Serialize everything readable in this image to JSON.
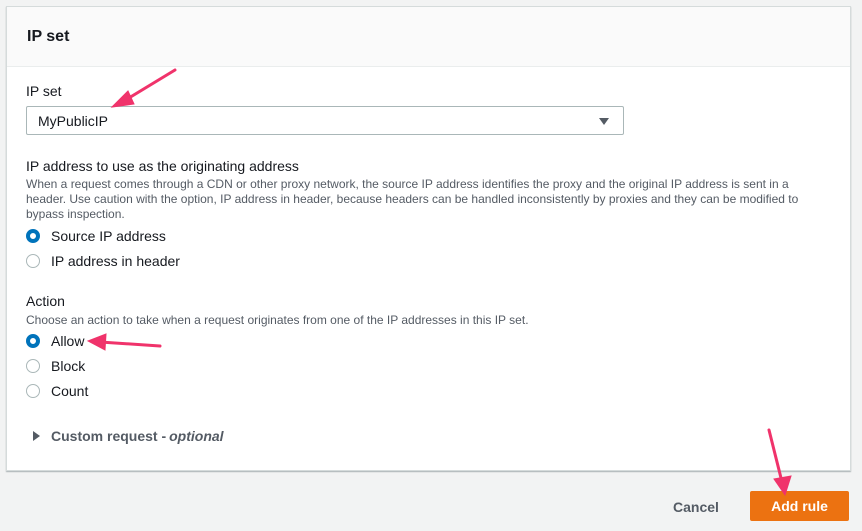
{
  "panel": {
    "title": "IP set"
  },
  "ipset": {
    "label": "IP set",
    "selected": "MyPublicIP"
  },
  "origin": {
    "label": "IP address to use as the originating address",
    "description": "When a request comes through a CDN or other proxy network, the source IP address identifies the proxy and the original IP address is sent in a header. Use caution with the option, IP address in header, because headers can be handled inconsistently by proxies and they can be modified to bypass inspection.",
    "options": [
      "Source IP address",
      "IP address in header"
    ],
    "selected": "Source IP address"
  },
  "action": {
    "label": "Action",
    "description": "Choose an action to take when a request originates from one of the IP addresses in this IP set.",
    "options": [
      "Allow",
      "Block",
      "Count"
    ],
    "selected": "Allow"
  },
  "custom": {
    "label": "Custom request - ",
    "optional": "optional"
  },
  "footer": {
    "cancel": "Cancel",
    "submit": "Add rule"
  },
  "colors": {
    "accent": "#ec7211",
    "radio": "#0073bb",
    "annotation_arrow": "#f0336b"
  }
}
